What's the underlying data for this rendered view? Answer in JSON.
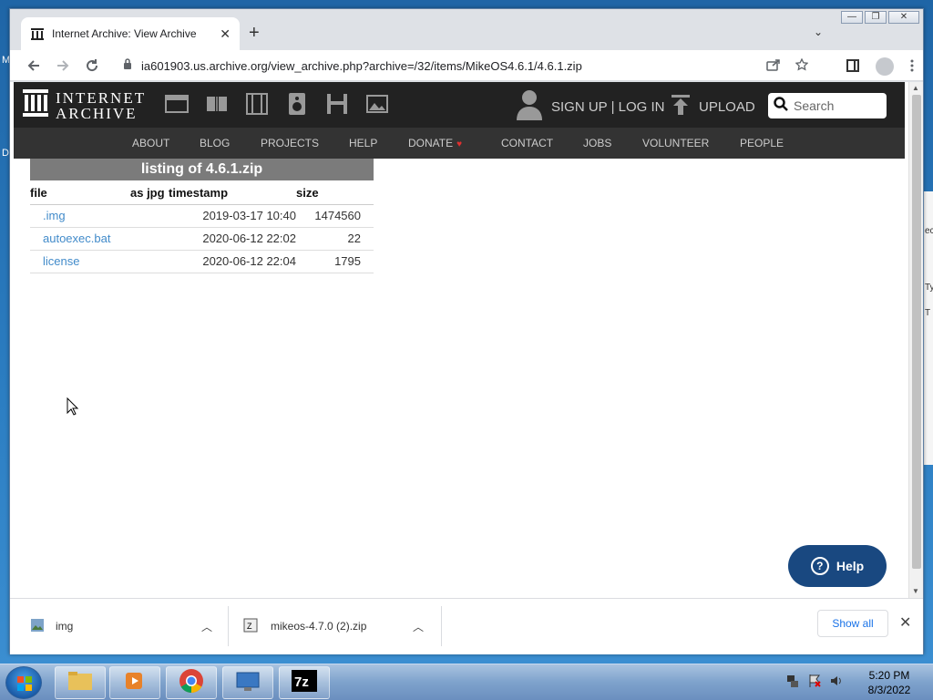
{
  "desktop": {
    "left_frag_top": "M",
    "left_frag_mid": "D",
    "bg_window_frags": [
      "ec",
      "Ty",
      "T"
    ]
  },
  "browser": {
    "tab_title": "Internet Archive: View Archive",
    "tab_close": "✕",
    "new_tab": "+",
    "tab_dropdown": "⌄",
    "url": "ia601903.us.archive.org/view_archive.php?archive=/32/items/MikeOS4.6.1/4.6.1.zip",
    "win_minimize": "—",
    "win_restore": "❐",
    "win_close": "✕"
  },
  "ia": {
    "logo_line1": "INTERNET",
    "logo_line2": "ARCHIVE",
    "signup": "SIGN UP | LOG IN",
    "upload": "UPLOAD",
    "search_placeholder": "Search",
    "subnav": [
      "ABOUT",
      "BLOG",
      "PROJECTS",
      "HELP",
      "DONATE",
      "CONTACT",
      "JOBS",
      "VOLUNTEER",
      "PEOPLE"
    ]
  },
  "listing": {
    "title": "listing of 4.6.1.zip",
    "headers": [
      "file",
      "as jpg",
      "timestamp",
      "size"
    ],
    "rows": [
      {
        "file": ".img",
        "timestamp": "2019-03-17 10:40",
        "size": "1474560"
      },
      {
        "file": "autoexec.bat",
        "timestamp": "2020-06-12 22:02",
        "size": "22"
      },
      {
        "file": "license",
        "timestamp": "2020-06-12 22:04",
        "size": "1795"
      }
    ]
  },
  "help_button": "Help",
  "downloads": {
    "items": [
      "img",
      "mikeos-4.7.0 (2).zip"
    ],
    "show_all": "Show all",
    "close": "✕"
  },
  "taskbar": {
    "time": "5:20 PM",
    "date": "8/3/2022",
    "seven_zip_label": "7z"
  }
}
